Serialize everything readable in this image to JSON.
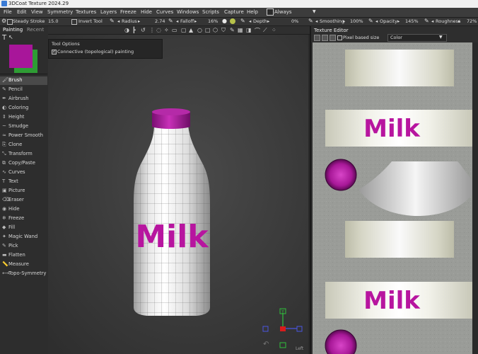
{
  "app": {
    "title": "3DCoat Texture 2024.29"
  },
  "menu": [
    "File",
    "Edit",
    "View",
    "Symmetry",
    "Textures",
    "Layers",
    "Freeze",
    "Hide",
    "Curves",
    "Windows",
    "Scripts",
    "Capture",
    "Help"
  ],
  "always": {
    "label": "Always"
  },
  "toolbar": {
    "steady_stroke": "Steady Stroke",
    "steady_value": "15.0",
    "invert_tool": "Invert Tool",
    "radius_label": "Radius",
    "radius_value": "2.74",
    "falloff_label": "Falloff",
    "falloff_value": "16%",
    "depth_label": "Depth",
    "depth_value": "0%",
    "smoothing_label": "Smoothing",
    "smoothing_value": "100%",
    "opacity_label": "Opacity",
    "opacity_value": "145%",
    "roughness_label": "Roughness",
    "roughness_value": "72%"
  },
  "left_panel": {
    "tabs": [
      "Painting",
      "Recent"
    ],
    "primary_color": "#a8169a",
    "secondary_color": "#2e9c34",
    "tools": [
      "Brush",
      "Pencil",
      "Airbrush",
      "Coloring",
      "Height",
      "Smudge",
      "Power Smooth",
      "Clone",
      "Transform",
      "Copy/Paste",
      "Curves",
      "Text",
      "Picture",
      "Eraser",
      "Hide",
      "Freeze",
      "Fill",
      "Magic Wand",
      "Pick",
      "Flatten",
      "Measure",
      "Topo-Symmetry"
    ],
    "active_tool": "Brush"
  },
  "tool_options": {
    "title": "Tool Options",
    "connective_label": "Connective (topological) painting",
    "connective_checked": true
  },
  "viewport": {
    "label_text": "Milk",
    "view_label": "Left",
    "gizmo": {
      "y": "Y"
    }
  },
  "texture_editor": {
    "title": "Texture Editor",
    "pixel_based_label": "Pixel based size",
    "channel": "Color",
    "label_text": "Milk"
  },
  "colors": {
    "accent_magenta": "#b7159f",
    "cap_magenta": "#a91aa0"
  }
}
